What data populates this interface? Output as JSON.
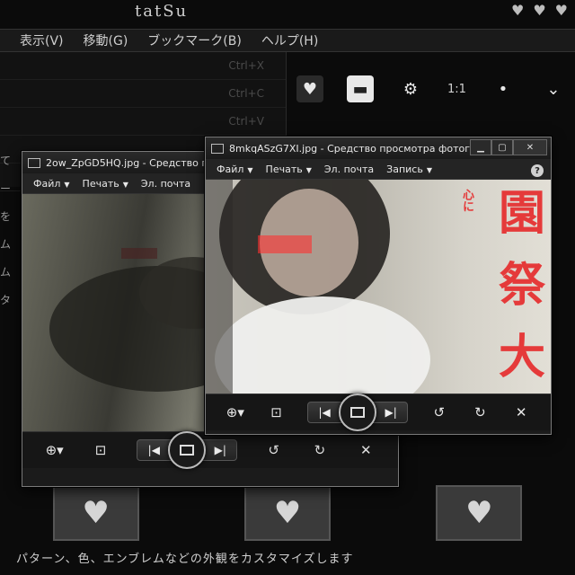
{
  "background": {
    "title": "tatSu",
    "menu": [
      "表示(V)",
      "移動(G)",
      "ブックマーク(B)",
      "ヘルプ(H)"
    ],
    "side_rows": [
      {
        "label": "",
        "shortcut": "Ctrl+X"
      },
      {
        "label": "",
        "shortcut": "Ctrl+C"
      },
      {
        "label": "",
        "shortcut": "Ctrl+V"
      },
      {
        "label": "",
        "shortcut": ""
      },
      {
        "label": "",
        "shortcut": ""
      }
    ],
    "zoom_label": "1:1",
    "left_strip": [
      "て",
      "ー",
      "を",
      "ム",
      "ム",
      "タ"
    ],
    "status_text": "パターン、色、エンブレムなどの外観をカスタマイズします"
  },
  "window_back": {
    "title": "2ow_ZpGD5HQ.jpg - Средство просм",
    "menu": [
      "Файл",
      "Печать",
      "Эл. почта"
    ],
    "menu_has_caret": [
      true,
      true,
      false
    ]
  },
  "window_front": {
    "title": "8mkqASzG7XI.jpg - Средство просмотра фотогра...",
    "menu": [
      "Файл",
      "Печать",
      "Эл. почта",
      "Запись"
    ],
    "menu_has_caret": [
      true,
      true,
      false,
      true
    ],
    "help": "?",
    "photo_text_small": "心に",
    "photo_text_large": [
      "園",
      "祭",
      "大"
    ]
  },
  "colors": {
    "accent_red": "#e53a3a",
    "window_frame": "#7a7a7a"
  },
  "icons": {
    "zoom": "🔍",
    "fit": "⊡",
    "prev": "|◀",
    "next": "▶|",
    "rotate_ccw": "↺",
    "rotate_cw": "↻",
    "delete": "✕"
  }
}
